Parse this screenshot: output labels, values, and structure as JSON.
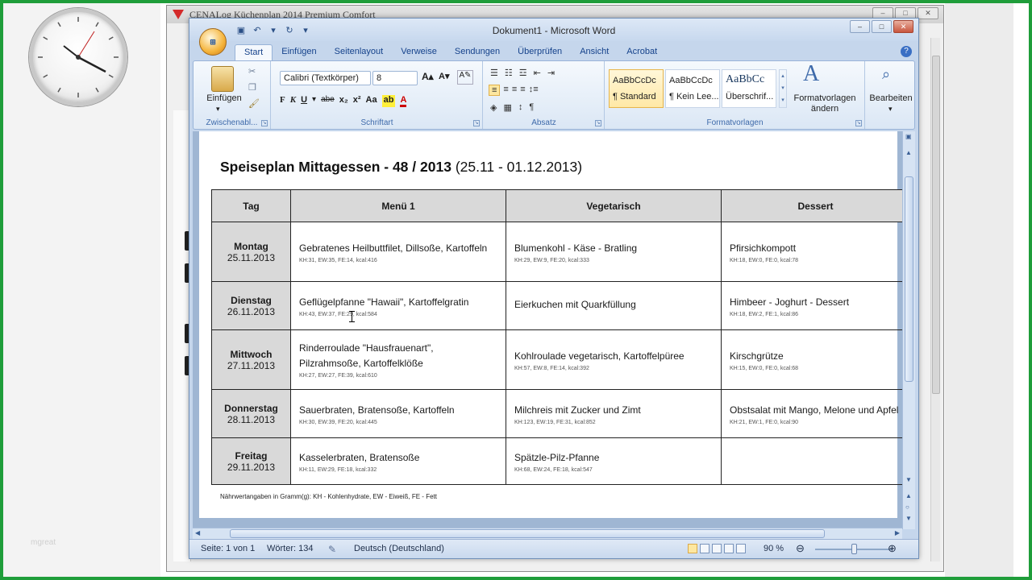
{
  "background_window": {
    "title": "CENALog Küchenplan 2014 Premium Comfort",
    "buttons": [
      "–",
      "□",
      "✕"
    ]
  },
  "word": {
    "title": "Dokument1 - Microsoft Word",
    "office_button": "Office",
    "window_buttons": [
      "–",
      "□",
      "✕"
    ],
    "tabs": [
      "Start",
      "Einfügen",
      "Seitenlayout",
      "Verweise",
      "Sendungen",
      "Überprüfen",
      "Ansicht",
      "Acrobat"
    ],
    "ribbon": {
      "clipboard": {
        "paste_label": "Einfügen",
        "group_label": "Zwischenabl..."
      },
      "font": {
        "font_name": "Calibri (Textkörper)",
        "font_size": "8",
        "group_label": "Schriftart",
        "format_buttons": [
          "F",
          "K",
          "U",
          "abe",
          "x₂",
          "x²",
          "Aa"
        ]
      },
      "paragraph": {
        "group_label": "Absatz"
      },
      "styles": {
        "items": [
          {
            "preview": "AaBbCcDc",
            "name": "¶ Standard"
          },
          {
            "preview": "AaBbCcDc",
            "name": "¶ Kein Lee..."
          },
          {
            "preview": "AaBbCc",
            "name": "Überschrif..."
          }
        ],
        "change_styles": "Formatvorlagen ändern",
        "group_label": "Formatvorlagen"
      },
      "editing": {
        "label": "Bearbeiten"
      }
    },
    "document": {
      "title_bold": "Speiseplan Mittagessen - 48 / 2013",
      "title_rest": "(25.11 - 01.12.2013)",
      "headers": [
        "Tag",
        "Menü 1",
        "Vegetarisch",
        "Dessert"
      ],
      "rows": [
        {
          "day": "Montag",
          "date": "25.11.2013",
          "menu": "Gebratenes Heilbuttfilet, Dillsoße, Kartoffeln",
          "menu_nut": "KH:31, EW:35, FE:14, kcal:416",
          "veg": "Blumenkohl - Käse - Bratling",
          "veg_nut": "KH:29, EW:9, FE:20, kcal:333",
          "dessert": "Pfirsichkompott",
          "dessert_nut": "KH:18, EW:0, FE:0, kcal:78"
        },
        {
          "day": "Dienstag",
          "date": "26.11.2013",
          "menu": "Geflügelpfanne \"Hawaii\", Kartoffelgratin",
          "menu_nut": "KH:43, EW:37, FE:29, kcal:584",
          "veg": "Eierkuchen mit Quarkfüllung",
          "veg_nut": "",
          "dessert": "Himbeer - Joghurt - Dessert",
          "dessert_nut": "KH:18, EW:2, FE:1, kcal:86"
        },
        {
          "day": "Mittwoch",
          "date": "27.11.2013",
          "menu": "Rinderroulade \"Hausfrauenart\", Pilzrahmsoße, Kartoffelklöße",
          "menu_nut": "KH:27, EW:27, FE:39, kcal:610",
          "veg": "Kohlroulade vegetarisch, Kartoffelpüree",
          "veg_nut": "KH:57, EW:8, FE:14, kcal:392",
          "dessert": "Kirschgrütze",
          "dessert_nut": "KH:15, EW:0, FE:0, kcal:68"
        },
        {
          "day": "Donnerstag",
          "date": "28.11.2013",
          "menu": "Sauerbraten, Bratensoße, Kartoffeln",
          "menu_nut": "KH:30, EW:39, FE:20, kcal:445",
          "veg": "Milchreis mit Zucker und Zimt",
          "veg_nut": "KH:123, EW:19, FE:31, kcal:852",
          "dessert": "Obstsalat mit Mango, Melone und Apfel",
          "dessert_nut": "KH:21, EW:1, FE:0, kcal:90"
        },
        {
          "day": "Freitag",
          "date": "29.11.2013",
          "menu": "Kasselerbraten, Bratensoße",
          "menu_nut": "KH:11, EW:29, FE:18, kcal:332",
          "veg": "Spätzle-Pilz-Pfanne",
          "veg_nut": "KH:68, EW:24, FE:18, kcal:547",
          "dessert": "",
          "dessert_nut": ""
        }
      ],
      "footnote": "Nährwertangaben in Gramm(g): KH - Kohlenhydrate, EW - Eiweiß, FE - Fett"
    },
    "status": {
      "page": "Seite: 1 von 1",
      "words": "Wörter: 134",
      "language": "Deutsch (Deutschland)",
      "zoom": "90 %"
    }
  },
  "watermark": "mgreat"
}
